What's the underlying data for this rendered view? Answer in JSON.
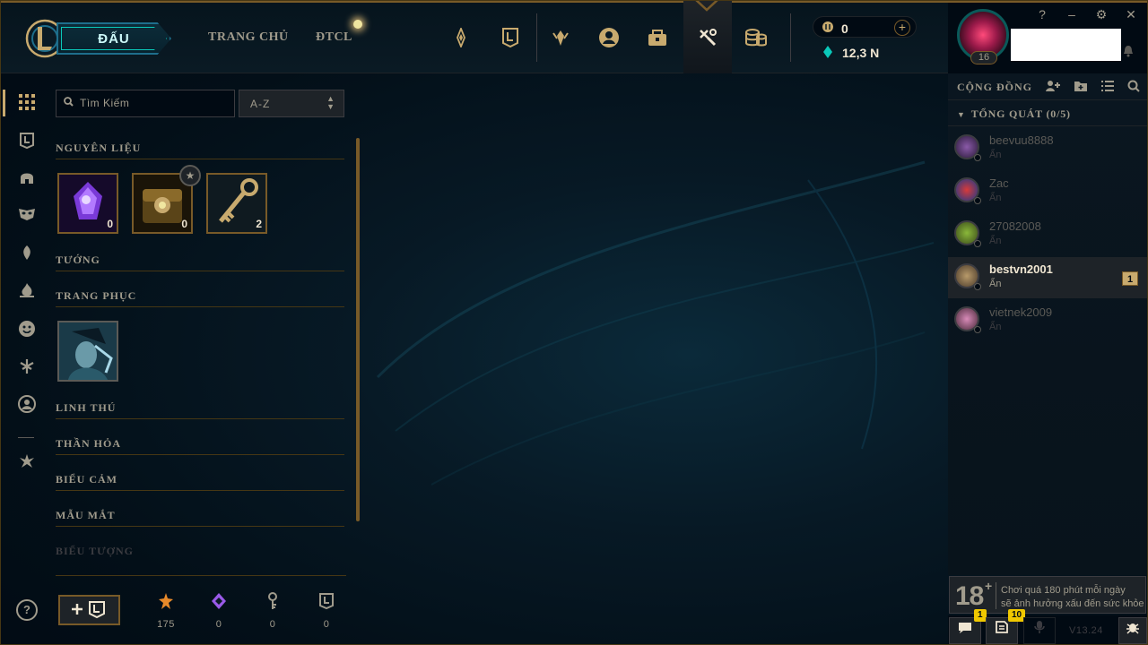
{
  "top_nav": {
    "play_label": "ĐẤU",
    "home_label": "TRANG CHỦ",
    "tft_label": "ĐTCL",
    "icons": [
      "esports-icon",
      "collection-icon",
      "ranked-icon",
      "profile-icon",
      "loot-icon",
      "crafting-icon",
      "store-icon"
    ]
  },
  "currency": {
    "rp_value": "0",
    "be_value": "12,3 N"
  },
  "profile": {
    "level": "16"
  },
  "window_controls": {
    "help": "?",
    "minimize": "–",
    "settings": "⚙",
    "close": "✕"
  },
  "collection": {
    "search_placeholder": "Tìm Kiếm",
    "sort_value": "A-Z",
    "sections": [
      {
        "title": "NGUYÊN LIỆU"
      },
      {
        "title": "TƯỚNG"
      },
      {
        "title": "TRANG PHỤC"
      },
      {
        "title": "LINH THÚ"
      },
      {
        "title": "THẦN HỎA"
      },
      {
        "title": "BIỂU CẢM"
      },
      {
        "title": "MẪU MẮT"
      },
      {
        "title": "BIỂU TƯỢNG"
      }
    ],
    "materials": [
      {
        "icon": "orb-icon",
        "count": "0"
      },
      {
        "icon": "chest-icon",
        "count": "0"
      },
      {
        "icon": "key-icon",
        "count": "2"
      }
    ]
  },
  "bottom_currencies": [
    {
      "icon": "orange-essence-icon",
      "value": "175"
    },
    {
      "icon": "mythic-essence-icon",
      "value": "0"
    },
    {
      "icon": "key-fragment-icon",
      "value": "0"
    },
    {
      "icon": "token-icon",
      "value": "0"
    }
  ],
  "social": {
    "title": "CỘNG ĐỒNG",
    "group_label": "TỔNG QUÁT (0/5)",
    "friends": [
      {
        "name": "beevuu8888",
        "status": "Ẩn",
        "badge": ""
      },
      {
        "name": "Zac",
        "status": "Ẩn",
        "badge": ""
      },
      {
        "name": "27082008",
        "status": "Ẩn",
        "badge": ""
      },
      {
        "name": "bestvn2001",
        "status": "Ẩn",
        "badge": "1"
      },
      {
        "name": "vietnek2009",
        "status": "Ẩn",
        "badge": ""
      }
    ]
  },
  "age_warning": {
    "rating": "18",
    "plus": "+",
    "line1": "Chơi quá 180 phút mỗi ngày",
    "line2": "sẽ ảnh hưởng xấu đến sức khỏe"
  },
  "status_bar": {
    "chat_badge": "1",
    "notes_badge": "10",
    "version": "V13.24"
  }
}
